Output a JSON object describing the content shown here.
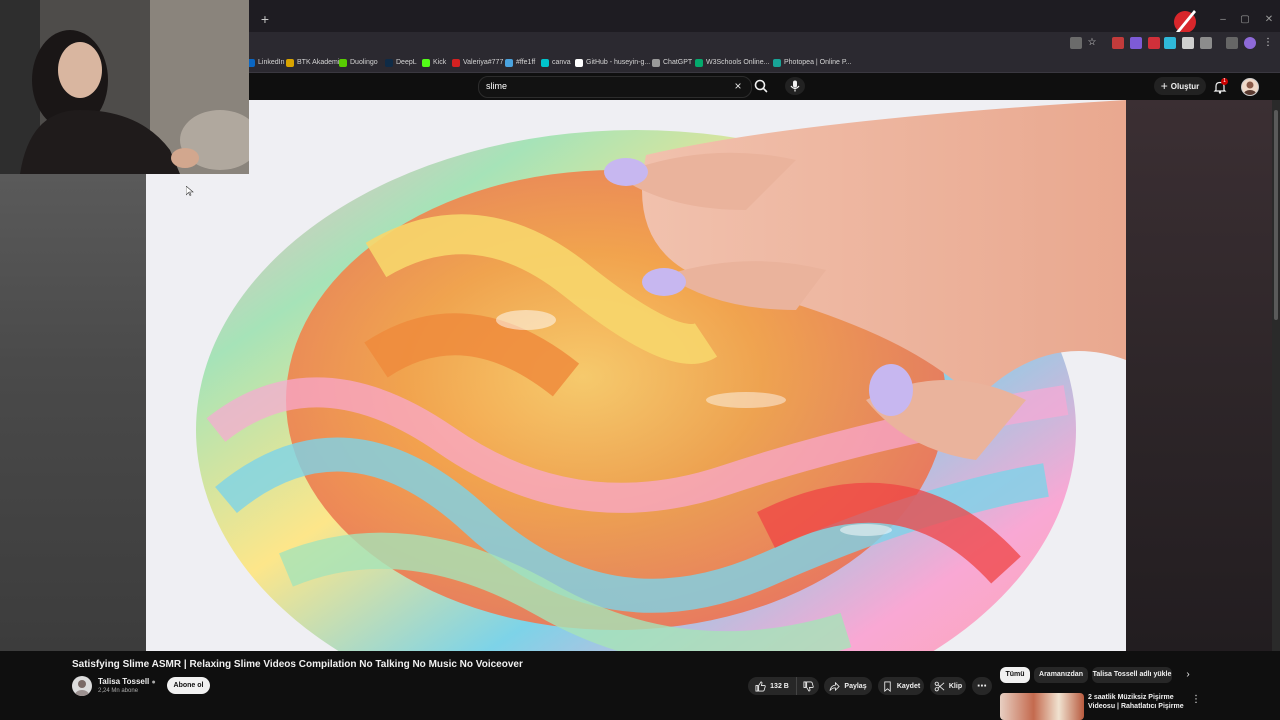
{
  "browser": {
    "new_tab_label": "+",
    "bookmarks": [
      {
        "label": "LinkedIn",
        "color": "#0a66c2"
      },
      {
        "label": "BTK Akademi",
        "color": "#d9a400"
      },
      {
        "label": "Duolingo",
        "color": "#58cc02"
      },
      {
        "label": "DeepL",
        "color": "#0f2b46"
      },
      {
        "label": "Kick",
        "color": "#53fc18"
      },
      {
        "label": "Valeriya#777",
        "color": "#d42121"
      },
      {
        "label": "#ffe1ff",
        "color": "#4aa3df"
      },
      {
        "label": "canva",
        "color": "#00c4cc"
      },
      {
        "label": "GitHub - huseyin-g...",
        "color": "#ffffff"
      },
      {
        "label": "ChatGPT",
        "color": "#9a9a9a"
      },
      {
        "label": "W3Schools Online...",
        "color": "#04aa6d"
      },
      {
        "label": "Photopea | Online P...",
        "color": "#18a497"
      }
    ]
  },
  "header": {
    "search_query": "slime",
    "clear_icon": "×",
    "create_label": "Oluştur",
    "notification_count": "1"
  },
  "video": {
    "title": "Satisfying Slime ASMR | Relaxing Slime Videos Compilation No Talking No Music No Voiceover",
    "channel_name": "Talisa Tossell",
    "subscribers": "2,24 Mn abone",
    "subscribe_label": "Abone ol",
    "likes": "132 B",
    "share_label": "Paylaş",
    "save_label": "Kaydet",
    "clip_label": "Klip",
    "more_label": "⋯"
  },
  "recommendations": {
    "chips": [
      "Tümü",
      "Aramanızdan",
      "Talisa Tossell adlı yükle"
    ],
    "first_title": "2 saatlik Müziksiz Pişirme Videosu | Rahatlatıcı Pişirme",
    "more_label": "⋮"
  },
  "colors": {
    "background": "#0f0f0f",
    "accent": "#cc0000",
    "chip_active": "#f1f1f1"
  }
}
